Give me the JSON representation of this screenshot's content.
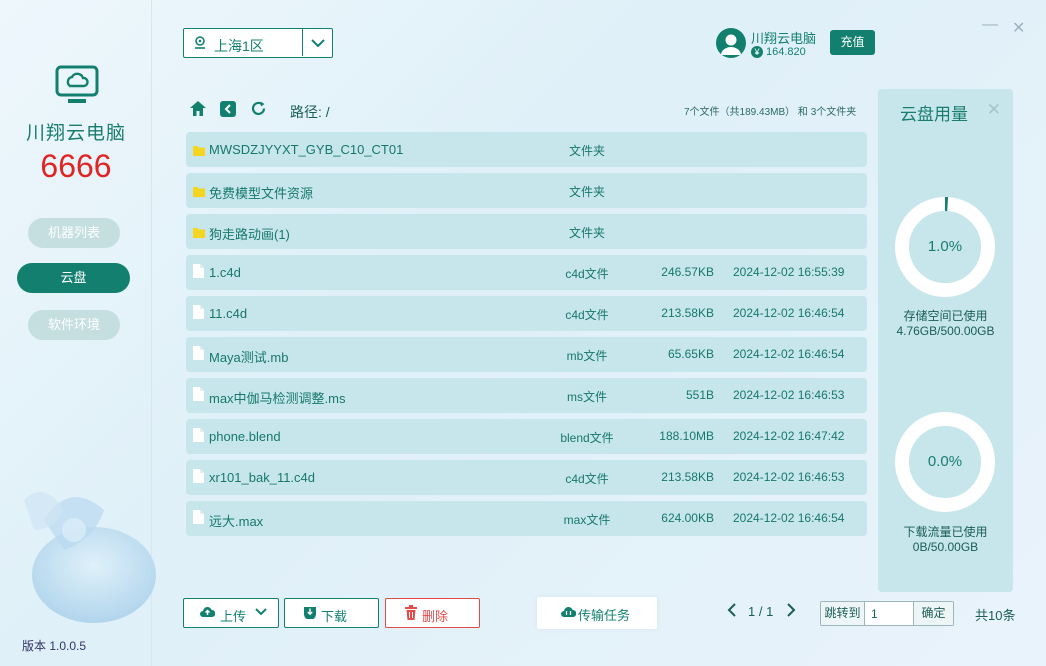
{
  "sidebar": {
    "brand": "川翔云电脑",
    "machine_number": "6666",
    "nav": [
      {
        "label": "机器列表",
        "active": false
      },
      {
        "label": "云盘",
        "active": true
      },
      {
        "label": "软件环境",
        "active": false
      }
    ],
    "version": "版本 1.0.0.5"
  },
  "header": {
    "region": "上海1区",
    "username": "川翔云电脑",
    "balance": "164.820",
    "recharge_label": "充值",
    "minimize_icon": "minimize-icon",
    "close_icon": "close-icon"
  },
  "toolbar": {
    "path_label": "路径: /",
    "summary": "7个文件（共189.43MB） 和 3个文件夹"
  },
  "files": [
    {
      "name": "MWSDZJYYXT_GYB_C10_CT01",
      "type": "文件夹",
      "size": "",
      "date": "",
      "folder": true
    },
    {
      "name": "免费模型文件资源",
      "type": "文件夹",
      "size": "",
      "date": "",
      "folder": true
    },
    {
      "name": "狗走路动画(1)",
      "type": "文件夹",
      "size": "",
      "date": "",
      "folder": true
    },
    {
      "name": "1.c4d",
      "type": "c4d文件",
      "size": "246.57KB",
      "date": "2024-12-02 16:55:39",
      "folder": false
    },
    {
      "name": "11.c4d",
      "type": "c4d文件",
      "size": "213.58KB",
      "date": "2024-12-02 16:46:54",
      "folder": false
    },
    {
      "name": "Maya测试.mb",
      "type": "mb文件",
      "size": "65.65KB",
      "date": "2024-12-02 16:46:54",
      "folder": false
    },
    {
      "name": "max中伽马检测调整.ms",
      "type": "ms文件",
      "size": "551B",
      "date": "2024-12-02 16:46:53",
      "folder": false
    },
    {
      "name": "phone.blend",
      "type": "blend文件",
      "size": "188.10MB",
      "date": "2024-12-02 16:47:42",
      "folder": false
    },
    {
      "name": "xr101_bak_11.c4d",
      "type": "c4d文件",
      "size": "213.58KB",
      "date": "2024-12-02 16:46:53",
      "folder": false
    },
    {
      "name": "远大.max",
      "type": "max文件",
      "size": "624.00KB",
      "date": "2024-12-02 16:46:54",
      "folder": false
    }
  ],
  "usage": {
    "title": "云盘用量",
    "storage_percent": "1.0%",
    "storage_fraction": 0.01,
    "storage_label": "存储空间已使用",
    "storage_value": "4.76GB/500.00GB",
    "traffic_percent": "0.0%",
    "traffic_fraction": 0.0,
    "traffic_label": "下载流量已使用",
    "traffic_value": "0B/50.00GB"
  },
  "actions": {
    "upload": "上传",
    "download": "下载",
    "delete": "删除",
    "transfers": "传输任务"
  },
  "pagination": {
    "current": "1 / 1",
    "jump_label": "跳转到",
    "jump_value": "1",
    "confirm": "确定",
    "total": "共10条"
  },
  "colors": {
    "primary": "#13806f",
    "danger": "#e34b4b",
    "accent_red": "#e02424"
  }
}
